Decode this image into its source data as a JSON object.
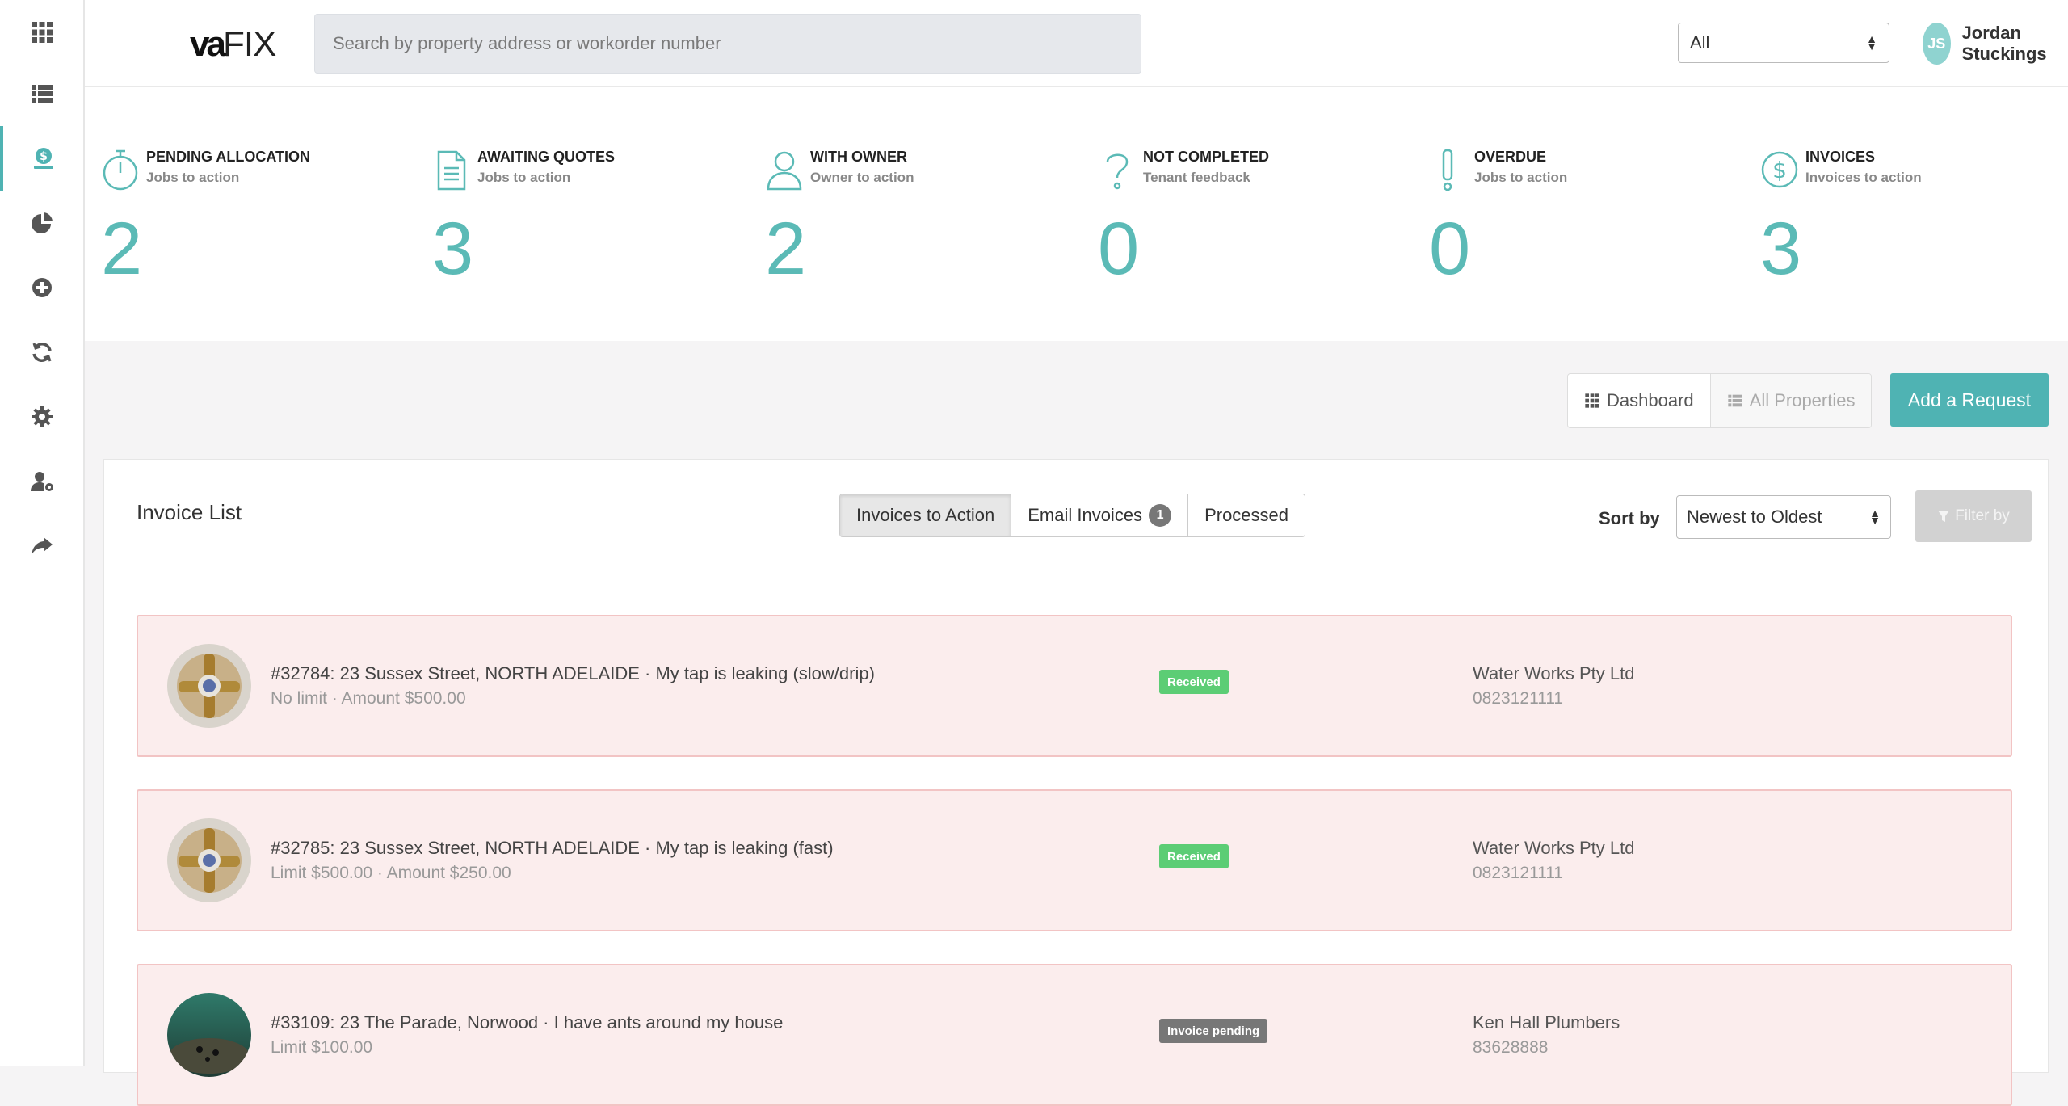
{
  "header": {
    "logo_bold": "va",
    "logo_light": "FIX",
    "search_placeholder": "Search by property address or workorder number",
    "scope_value": "All",
    "user_initials": "JS",
    "user_name": "Jordan Stuckings"
  },
  "sidebar": {
    "items": [
      {
        "icon": "apps-grid-icon",
        "active": false
      },
      {
        "icon": "list-icon",
        "active": false
      },
      {
        "icon": "money-icon",
        "active": true
      },
      {
        "icon": "pie-chart-icon",
        "active": false
      },
      {
        "icon": "add-circle-icon",
        "active": false
      },
      {
        "icon": "refresh-icon",
        "active": false
      },
      {
        "icon": "gear-icon",
        "active": false
      },
      {
        "icon": "user-settings-icon",
        "active": false
      },
      {
        "icon": "share-icon",
        "active": false
      }
    ]
  },
  "stats": [
    {
      "title": "PENDING ALLOCATION",
      "sub": "Jobs to action",
      "count": "2",
      "icon": "stopwatch-icon"
    },
    {
      "title": "AWAITING QUOTES",
      "sub": "Jobs to action",
      "count": "3",
      "icon": "document-icon"
    },
    {
      "title": "WITH OWNER",
      "sub": "Owner to action",
      "count": "2",
      "icon": "user-icon"
    },
    {
      "title": "NOT COMPLETED",
      "sub": "Tenant feedback",
      "count": "0",
      "icon": "question-icon"
    },
    {
      "title": "OVERDUE",
      "sub": "Jobs to action",
      "count": "0",
      "icon": "exclamation-icon"
    },
    {
      "title": "INVOICES",
      "sub": "Invoices to action",
      "count": "3",
      "icon": "dollar-icon"
    }
  ],
  "toolbar": {
    "dashboard_label": "Dashboard",
    "all_properties_label": "All Properties",
    "add_request_label": "Add a Request"
  },
  "invoice_list": {
    "title": "Invoice List",
    "tabs": [
      {
        "label": "Invoices to Action",
        "active": true
      },
      {
        "label": "Email Invoices",
        "badge": "1",
        "active": false
      },
      {
        "label": "Processed",
        "active": false
      }
    ],
    "sort_label": "Sort by",
    "sort_value": "Newest to Oldest",
    "filter_label": "Filter by",
    "rows": [
      {
        "title": "#32784: 23 Sussex Street, NORTH ADELAIDE · My tap is leaking (slow/drip)",
        "sub": "No limit · Amount $500.00",
        "status": "Received",
        "status_color": "#5ccd75",
        "supplier": "Water Works Pty Ltd",
        "phone": "0823121111",
        "thumb": "tap-photo"
      },
      {
        "title": "#32785: 23 Sussex Street, NORTH ADELAIDE · My tap is leaking (fast)",
        "sub": "Limit $500.00 · Amount $250.00",
        "status": "Received",
        "status_color": "#5ccd75",
        "supplier": "Water Works Pty Ltd",
        "phone": "0823121111",
        "thumb": "tap-photo"
      },
      {
        "title": "#33109: 23 The Parade, Norwood · I have ants around my house",
        "sub": "Limit $100.00",
        "status": "Invoice pending",
        "status_color": "#777777",
        "supplier": "Ken Hall Plumbers",
        "phone": "83628888",
        "thumb": "ants-photo"
      }
    ]
  },
  "colors": {
    "accent": "#4fb3b3",
    "count": "#5bbab6",
    "row_bg": "#fbeded",
    "row_border": "#f2c4c4"
  }
}
